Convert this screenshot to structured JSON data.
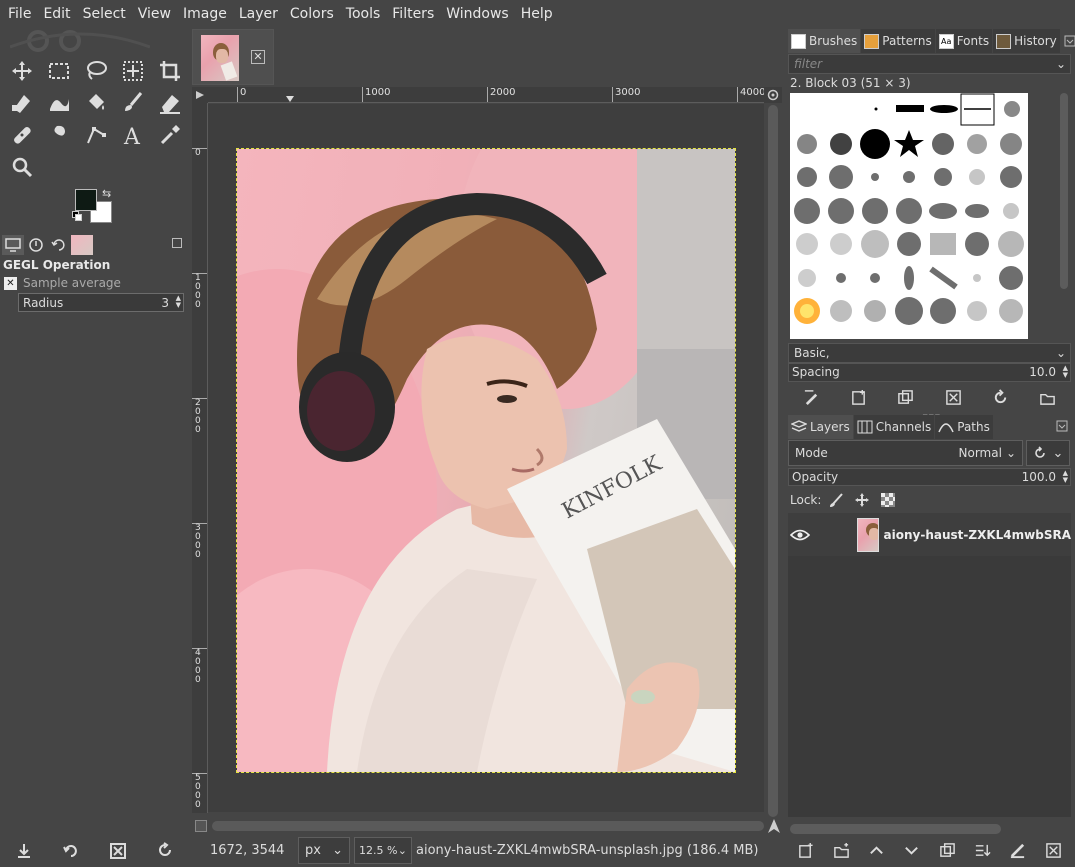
{
  "menubar": {
    "items": [
      "File",
      "Edit",
      "Select",
      "View",
      "Image",
      "Layer",
      "Colors",
      "Tools",
      "Filters",
      "Windows",
      "Help"
    ]
  },
  "tool_options": {
    "title": "GEGL Operation",
    "sample_label": "Sample average",
    "radius_label": "Radius",
    "radius_value": "3"
  },
  "image_window": {
    "ruler_h_labels": [
      "0",
      "1000",
      "2000",
      "3000",
      "4000"
    ],
    "ruler_v_labels": [
      "0",
      "1\n0\n0\n0",
      "2\n0\n0\n0",
      "3\n0\n0\n0",
      "4\n0\n0\n0",
      "5\n0\n0\n0"
    ],
    "status": {
      "coords": "1672, 3544",
      "unit": "px",
      "zoom": "12.5 %",
      "message": "aiony-haust-ZXKL4mwbSRA-unsplash.jpg (186.4 MB)"
    }
  },
  "brushes_dock": {
    "tabs": [
      "Brushes",
      "Patterns",
      "Fonts",
      "History"
    ],
    "filter_placeholder": "filter",
    "selected_brush": "2. Block 03 (51 × 3)",
    "preset": "Basic,",
    "spacing_label": "Spacing",
    "spacing_value": "10.0"
  },
  "layers_dock": {
    "tabs": [
      "Layers",
      "Channels",
      "Paths"
    ],
    "mode_label": "Mode",
    "mode_value": "Normal",
    "opacity_label": "Opacity",
    "opacity_value": "100.0",
    "lock_label": "Lock:",
    "layers": [
      {
        "name": "aiony-haust-ZXKL4mwbSRA",
        "visible": true
      }
    ]
  },
  "colors": {
    "foreground": "#0e1a14",
    "background": "#ffffff",
    "selection_outline": "#e5e542"
  }
}
